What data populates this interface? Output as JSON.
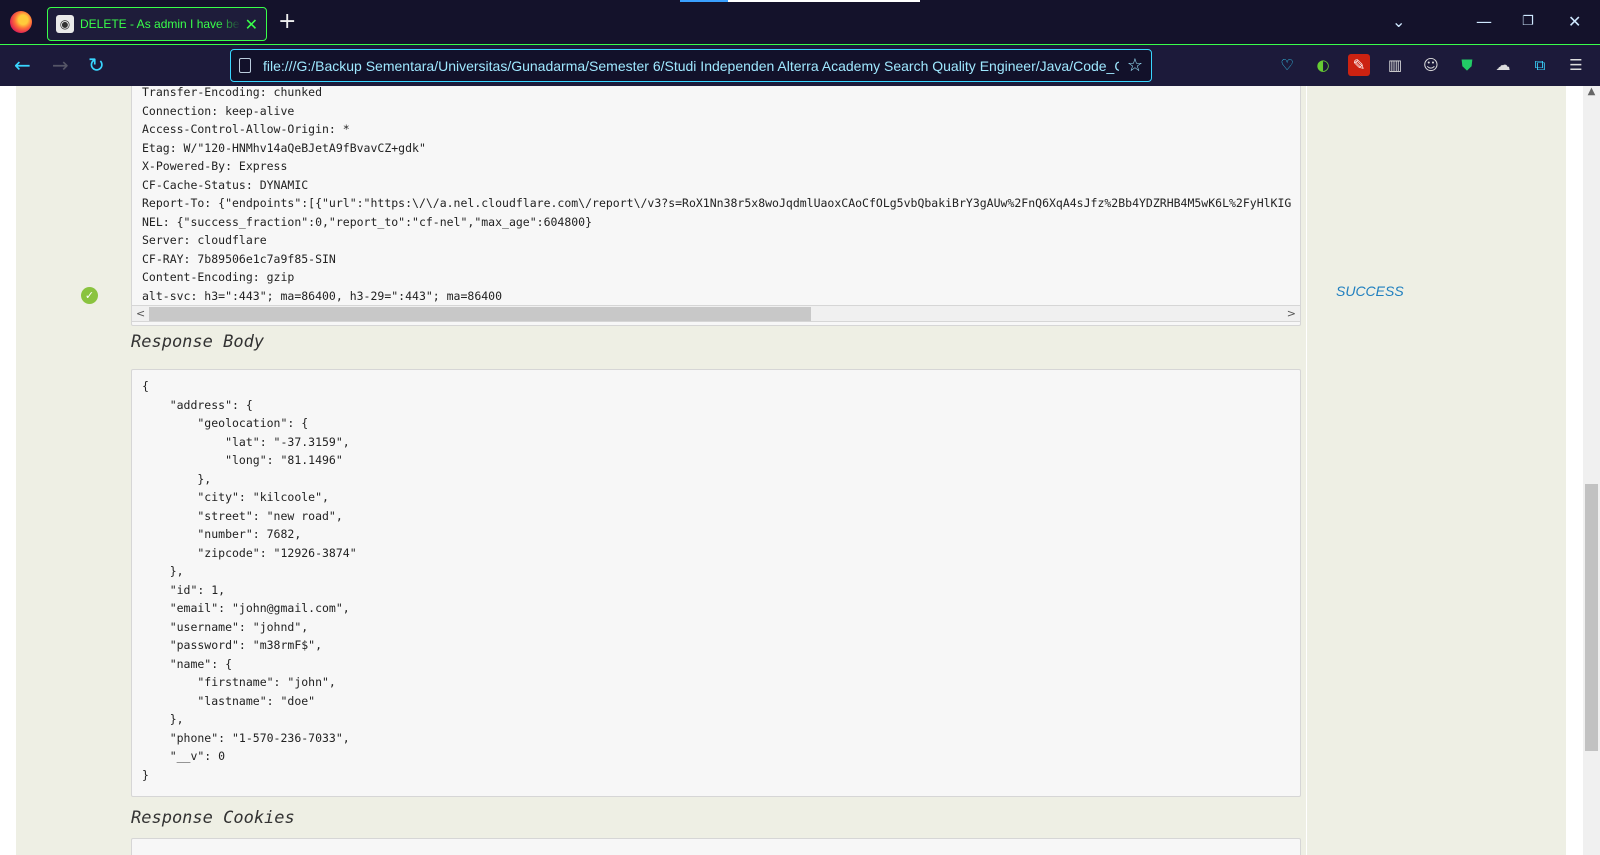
{
  "browser": {
    "tab_title": "DELETE - As admin I have be able to delete user",
    "new_tab_label": "+",
    "url": "file:///G:/Backup Sementara/Universitas/Gunadarma/Semester 6/Studi Independen Alterra Academy Search Quality Engineer/Java/Code_Commerce/target/cucumber-reports.html"
  },
  "response_headers": [
    "Transfer-Encoding: chunked",
    "Connection: keep-alive",
    "Access-Control-Allow-Origin: *",
    "Etag: W/\"120-HNMhv14aQeBJetA9fBvavCZ+gdk\"",
    "X-Powered-By: Express",
    "CF-Cache-Status: DYNAMIC",
    "Report-To: {\"endpoints\":[{\"url\":\"https:\\/\\/a.nel.cloudflare.com\\/report\\/v3?s=RoX1Nn38r5x8woJqdmlUaoxCAoCfOLg5vbQbakiBrY3gAUw%2FnQ6XqA4sJfz%2Bb4YDZRHB4M5wK6L%2FyHlKIG",
    "NEL: {\"success_fraction\":0,\"report_to\":\"cf-nel\",\"max_age\":604800}",
    "Server: cloudflare",
    "CF-RAY: 7b89506e1c7a9f85-SIN",
    "Content-Encoding: gzip",
    "alt-svc: h3=\":443\"; ma=86400, h3-29=\":443\"; ma=86400"
  ],
  "status": "SUCCESS",
  "sections": {
    "response_body": "Response Body",
    "response_cookies": "Response Cookies"
  },
  "response_body_lines": [
    "{",
    "    \"address\": {",
    "        \"geolocation\": {",
    "            \"lat\": \"-37.3159\",",
    "            \"long\": \"81.1496\"",
    "        },",
    "        \"city\": \"kilcoole\",",
    "        \"street\": \"new road\",",
    "        \"number\": 7682,",
    "        \"zipcode\": \"12926-3874\"",
    "    },",
    "    \"id\": 1,",
    "    \"email\": \"john@gmail.com\",",
    "    \"username\": \"johnd\",",
    "    \"password\": \"m38rmF$\",",
    "    \"name\": {",
    "        \"firstname\": \"john\",",
    "        \"lastname\": \"doe\"",
    "    },",
    "    \"phone\": \"1-570-236-7033\",",
    "    \"__v\": 0",
    "}"
  ],
  "icons": {
    "back": "arrow-left-icon",
    "forward": "arrow-right-icon",
    "reload": "reload-icon",
    "bookmark": "star-icon",
    "success": "check-circle-icon"
  },
  "colors": {
    "accent_green": "#39ff4a",
    "accent_cyan": "#39d6ff",
    "status_blue": "#1f7fbf",
    "success_green": "#8ac33f"
  }
}
